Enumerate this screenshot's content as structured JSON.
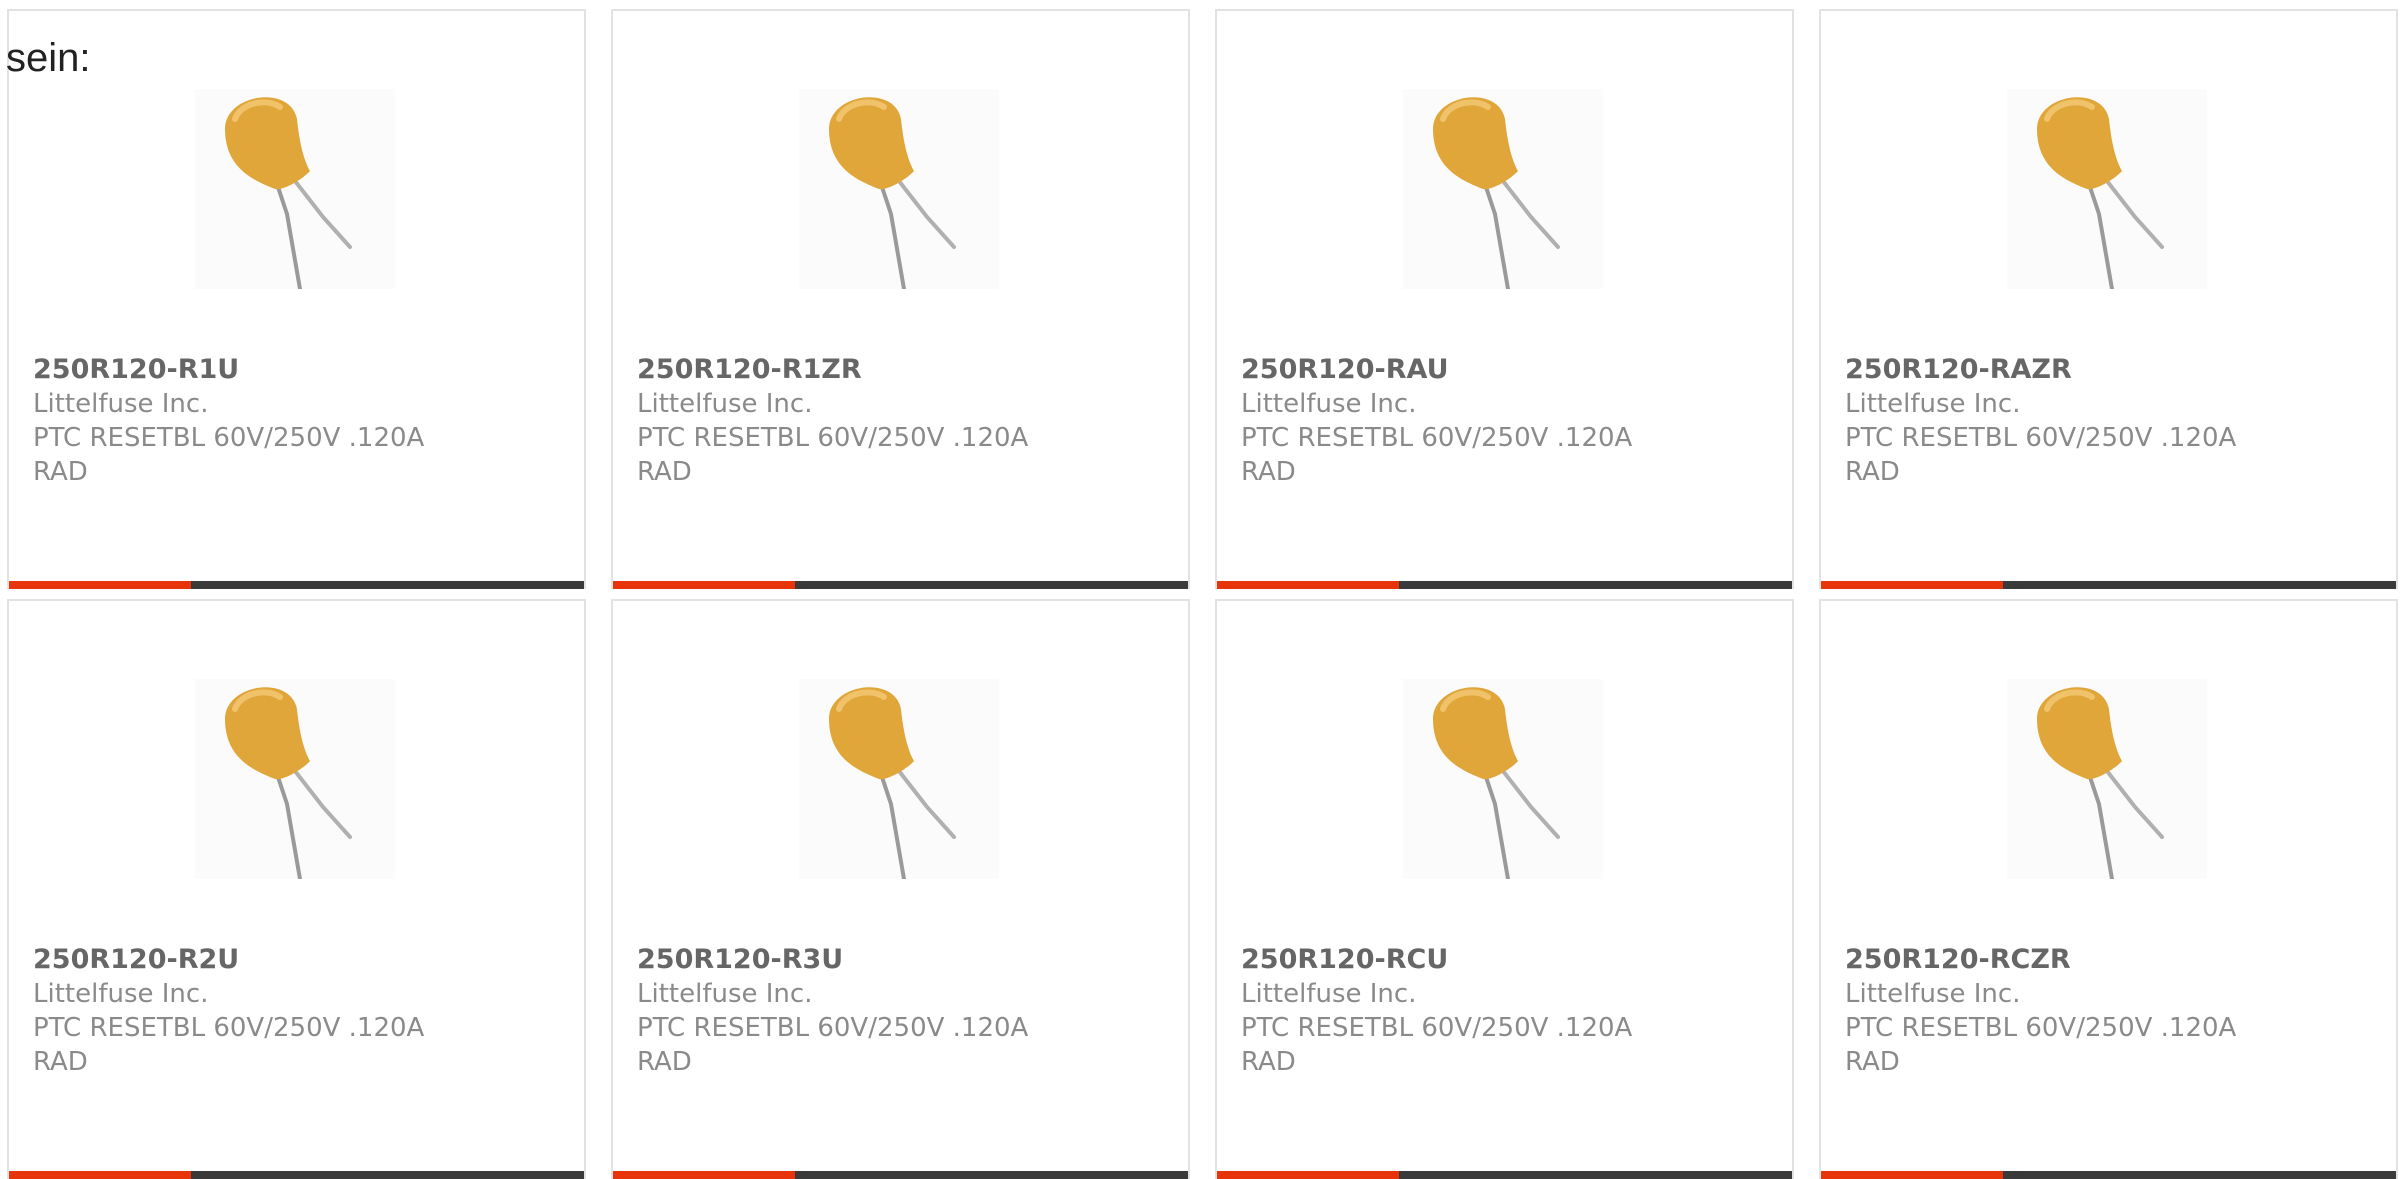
{
  "intro_text": "sein:",
  "colors": {
    "accent": "#e8340a",
    "bar": "#3a3a3a",
    "part_number": "#666666",
    "secondary_text": "#8a8a8a",
    "component_body": "#e0a63a"
  },
  "product_icon": "radial-ptc-fuse-image",
  "products": [
    {
      "part_number": "250R120-R1U",
      "manufacturer": "Littelfuse Inc.",
      "description_line1": "PTC RESETBL 60V/250V .120A",
      "description_line2": "RAD"
    },
    {
      "part_number": "250R120-R1ZR",
      "manufacturer": "Littelfuse Inc.",
      "description_line1": "PTC RESETBL 60V/250V .120A",
      "description_line2": "RAD"
    },
    {
      "part_number": "250R120-RAU",
      "manufacturer": "Littelfuse Inc.",
      "description_line1": "PTC RESETBL 60V/250V .120A",
      "description_line2": "RAD"
    },
    {
      "part_number": "250R120-RAZR",
      "manufacturer": "Littelfuse Inc.",
      "description_line1": "PTC RESETBL 60V/250V .120A",
      "description_line2": "RAD"
    },
    {
      "part_number": "250R120-R2U",
      "manufacturer": "Littelfuse Inc.",
      "description_line1": "PTC RESETBL 60V/250V .120A",
      "description_line2": "RAD"
    },
    {
      "part_number": "250R120-R3U",
      "manufacturer": "Littelfuse Inc.",
      "description_line1": "PTC RESETBL 60V/250V .120A",
      "description_line2": "RAD"
    },
    {
      "part_number": "250R120-RCU",
      "manufacturer": "Littelfuse Inc.",
      "description_line1": "PTC RESETBL 60V/250V .120A",
      "description_line2": "RAD"
    },
    {
      "part_number": "250R120-RCZR",
      "manufacturer": "Littelfuse Inc.",
      "description_line1": "PTC RESETBL 60V/250V .120A",
      "description_line2": "RAD"
    }
  ]
}
